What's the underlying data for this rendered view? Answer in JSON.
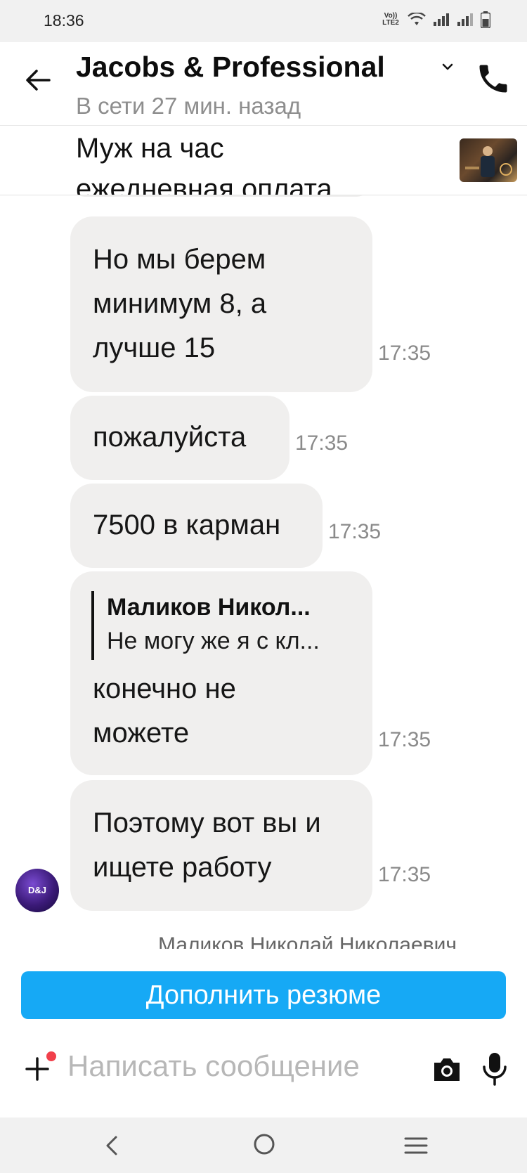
{
  "status_bar": {
    "time": "18:36",
    "volte_label": "Vo)) LTE2"
  },
  "header": {
    "title": "Jacobs & Professional",
    "subtitle": "В сети 27 мин. назад"
  },
  "vacancy": {
    "line1": "Муж на час",
    "line2": "ежедневная оплата"
  },
  "messages": [
    {
      "lines": [
        "Но мы берем",
        "минимум 8, а",
        "лучше 15"
      ],
      "time": "17:35"
    },
    {
      "lines": [
        "пожалуйста"
      ],
      "time": "17:35"
    },
    {
      "lines": [
        "7500 в карман"
      ],
      "time": "17:35"
    },
    {
      "quote_author": "Маликов Никол...",
      "quote_text": "Не могу же я с кл...",
      "lines": [
        "конечно не",
        "можете"
      ],
      "time": "17:35"
    },
    {
      "lines": [
        "Поэтому вот вы и",
        "ищете работу"
      ],
      "time": "17:35"
    }
  ],
  "avatar_label": "D&J",
  "sender_peek": "Маликов Николай Николаевич",
  "resume_button": "Дополнить резюме",
  "composer": {
    "placeholder": "Написать сообщение"
  },
  "colors": {
    "bubble_bg": "#f0efee",
    "accent_button": "#16a9f5",
    "notification_dot": "#f1404b"
  }
}
